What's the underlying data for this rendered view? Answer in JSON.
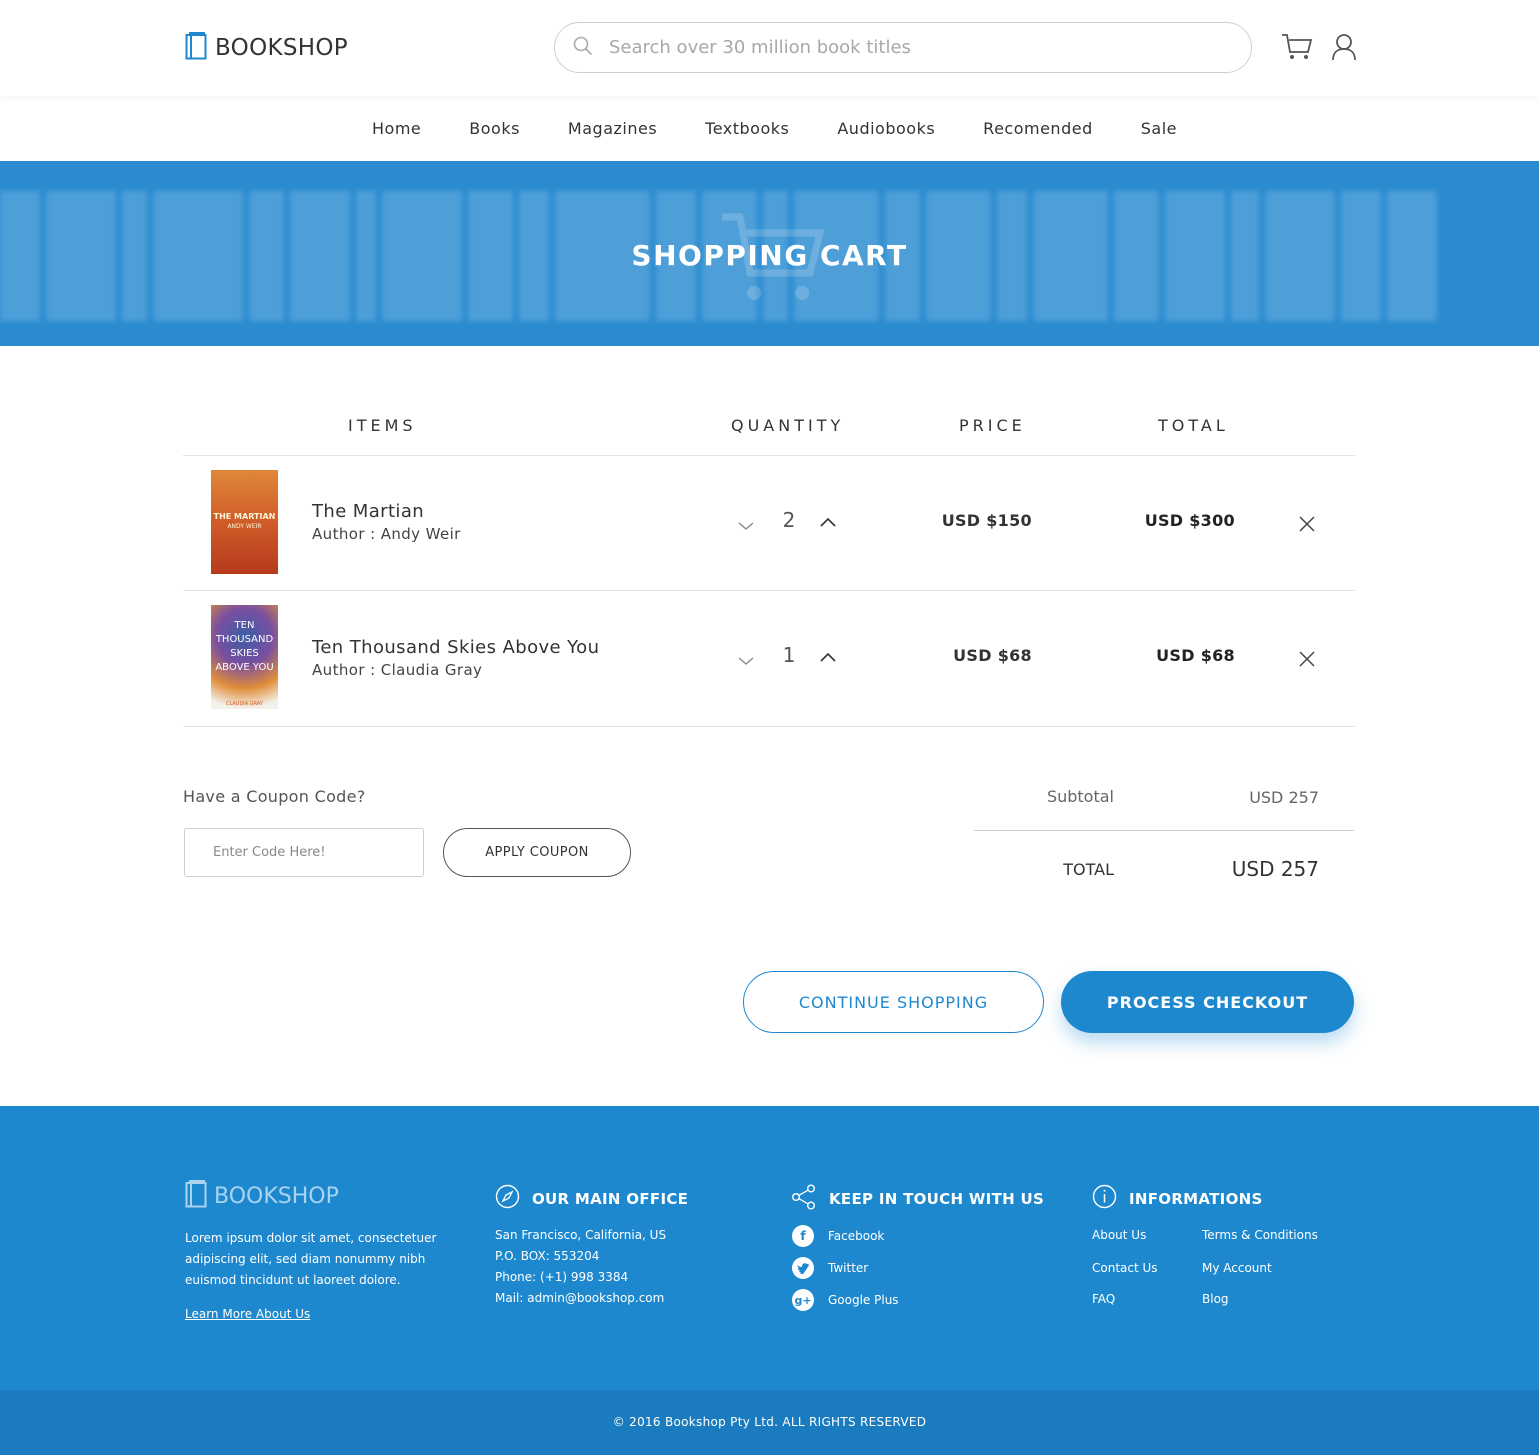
{
  "header": {
    "logo_text": "BOOKSHOP",
    "search_placeholder": "Search over 30 million book titles"
  },
  "nav": {
    "items": [
      "Home",
      "Books",
      "Magazines",
      "Textbooks",
      "Audiobooks",
      "Recomended",
      "Sale"
    ]
  },
  "banner": {
    "title": "SHOPPING CART"
  },
  "table": {
    "headers": {
      "items": "ITEMS",
      "quantity": "QUANTITY",
      "price": "PRICE",
      "total": "TOTAL"
    },
    "rows": [
      {
        "title": "The Martian",
        "author": "Author : Andy Weir",
        "quantity": "2",
        "price": "USD $150",
        "total": "USD $300",
        "cover_text": "THE MARTIAN",
        "cover_sub": "ANDY WEIR"
      },
      {
        "title": "Ten Thousand Skies Above You",
        "author": "Author : Claudia Gray",
        "quantity": "1",
        "price": "USD $68",
        "total": "USD $68",
        "cover_text": "TEN THOUSAND SKIES ABOVE YOU",
        "cover_sub": "CLAUDIA GRAY"
      }
    ]
  },
  "coupon": {
    "label": "Have a Coupon Code?",
    "placeholder": "Enter Code Here!",
    "button": "APPLY COUPON"
  },
  "summary": {
    "subtotal_label": "Subtotal",
    "subtotal_value": "USD 257",
    "total_label": "TOTAL",
    "total_value": "USD 257"
  },
  "actions": {
    "continue": "CONTINUE SHOPPING",
    "checkout": "PROCESS CHECKOUT"
  },
  "footer": {
    "logo_text": "BOOKSHOP",
    "about": "Lorem ipsum dolor sit amet, consectetuer adipiscing elit, sed diam nonummy nibh euismod tincidunt ut laoreet dolore.",
    "learn_more": "Learn More About Us",
    "office": {
      "heading": "OUR MAIN OFFICE",
      "lines": [
        "San Francisco, California, US",
        "P.O. BOX: 553204",
        "Phone: (+1) 998 3384",
        "Mail: admin@bookshop.com"
      ]
    },
    "social": {
      "heading": "KEEP IN TOUCH WITH US",
      "items": [
        "Facebook",
        "Twitter",
        "Google Plus"
      ]
    },
    "info": {
      "heading": "INFORMATIONS",
      "col1": [
        "About Us",
        "Contact Us",
        "FAQ"
      ],
      "col2": [
        "Terms & Conditions",
        "My Account",
        "Blog"
      ]
    },
    "copyright": "© 2016 Bookshop Pty Ltd. ALL RIGHTS RESERVED"
  },
  "colors": {
    "accent": "#1e88cf",
    "banner": "#2a8bd0",
    "footer_bottom": "#1a7cbf"
  }
}
